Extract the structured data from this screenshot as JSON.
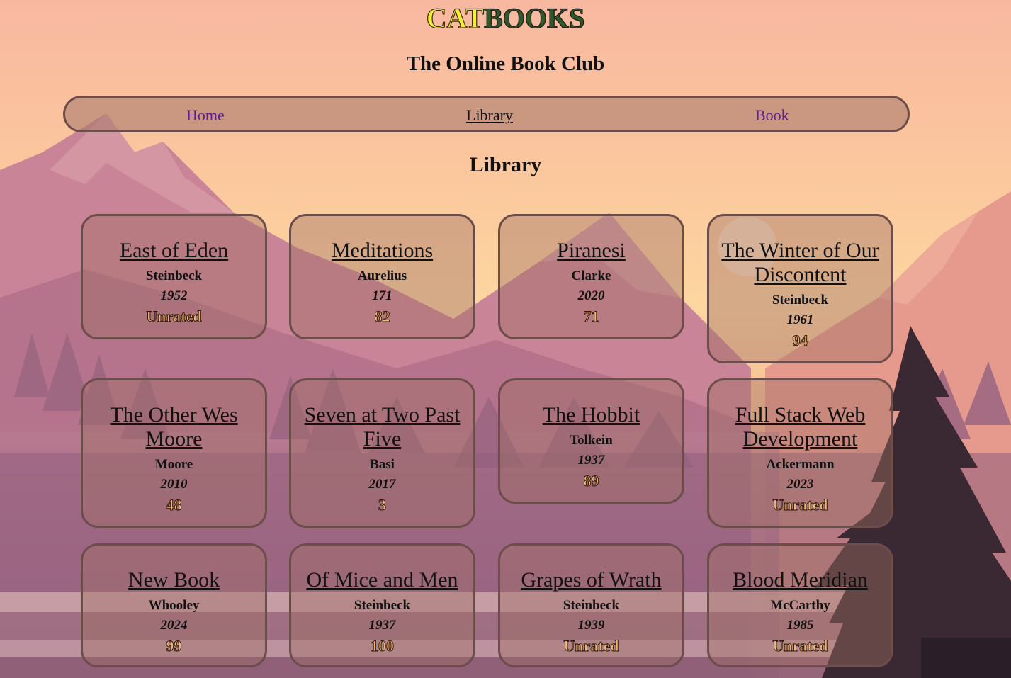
{
  "header": {
    "logo_part1": "CAT",
    "logo_part2": "BOOKS",
    "subtitle": "The Online Book Club"
  },
  "nav": {
    "items": [
      {
        "label": "Home",
        "active": false
      },
      {
        "label": "Library",
        "active": true
      },
      {
        "label": "Book",
        "active": false
      }
    ]
  },
  "main": {
    "title": "Library",
    "books": [
      {
        "title": "East of Eden",
        "author": "Steinbeck",
        "year": "1952",
        "rating": "Unrated"
      },
      {
        "title": "Meditations",
        "author": "Aurelius",
        "year": "171",
        "rating": "82"
      },
      {
        "title": "Piranesi",
        "author": "Clarke",
        "year": "2020",
        "rating": "71"
      },
      {
        "title": "The Winter of Our Discontent",
        "author": "Steinbeck",
        "year": "1961",
        "rating": "94"
      },
      {
        "title": "The Other Wes Moore",
        "author": "Moore",
        "year": "2010",
        "rating": "48"
      },
      {
        "title": "Seven at Two Past Five",
        "author": "Basi",
        "year": "2017",
        "rating": "3"
      },
      {
        "title": "The Hobbit",
        "author": "Tolkein",
        "year": "1937",
        "rating": "89"
      },
      {
        "title": "Full Stack Web Development",
        "author": "Ackermann",
        "year": "2023",
        "rating": "Unrated"
      },
      {
        "title": "New Book",
        "author": "Whooley",
        "year": "2024",
        "rating": "99"
      },
      {
        "title": "Of Mice and Men",
        "author": "Steinbeck",
        "year": "1937",
        "rating": "100"
      },
      {
        "title": "Grapes of Wrath",
        "author": "Steinbeck",
        "year": "1939",
        "rating": "Unrated"
      },
      {
        "title": "Blood Meridian",
        "author": "McCarthy",
        "year": "1985",
        "rating": "Unrated"
      }
    ]
  },
  "colors": {
    "logo_cat": "#f3f12f",
    "logo_books": "#2f5a27",
    "link": "#5b1e88",
    "rating": "#f3b46c",
    "card_border": "#6c4d4a"
  }
}
